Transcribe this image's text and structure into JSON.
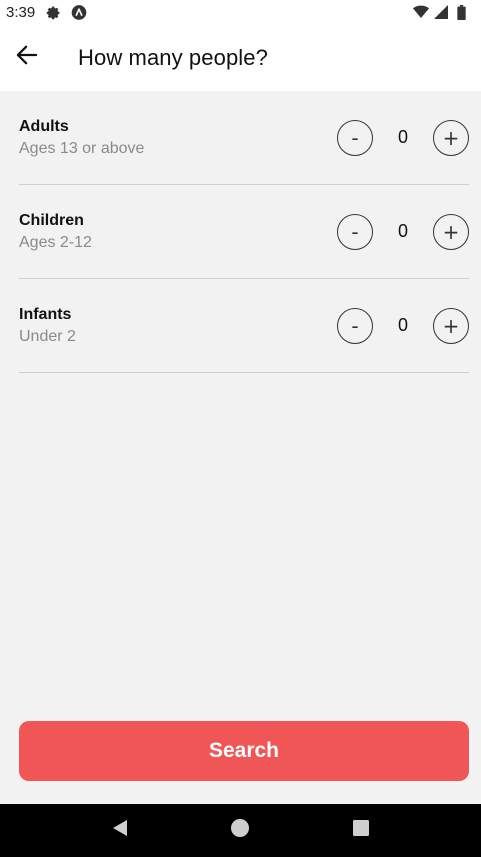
{
  "status_bar": {
    "time": "3:39",
    "icons": [
      "gear-icon",
      "app-a-icon",
      "wifi-icon",
      "signal-icon",
      "battery-icon"
    ]
  },
  "header": {
    "title": "How many people?",
    "back_icon": "arrow-left-icon"
  },
  "rows": [
    {
      "label": "Adults",
      "sublabel": "Ages 13 or above",
      "minus": "-",
      "value": "0",
      "plus": "+"
    },
    {
      "label": "Children",
      "sublabel": "Ages 2-12",
      "minus": "-",
      "value": "0",
      "plus": "+"
    },
    {
      "label": "Infants",
      "sublabel": "Under 2",
      "minus": "-",
      "value": "0",
      "plus": "+"
    }
  ],
  "search_button": {
    "label": "Search",
    "color": "#f05656"
  },
  "nav": {
    "icons": [
      "back-triangle-icon",
      "home-circle-icon",
      "recents-square-icon"
    ]
  }
}
